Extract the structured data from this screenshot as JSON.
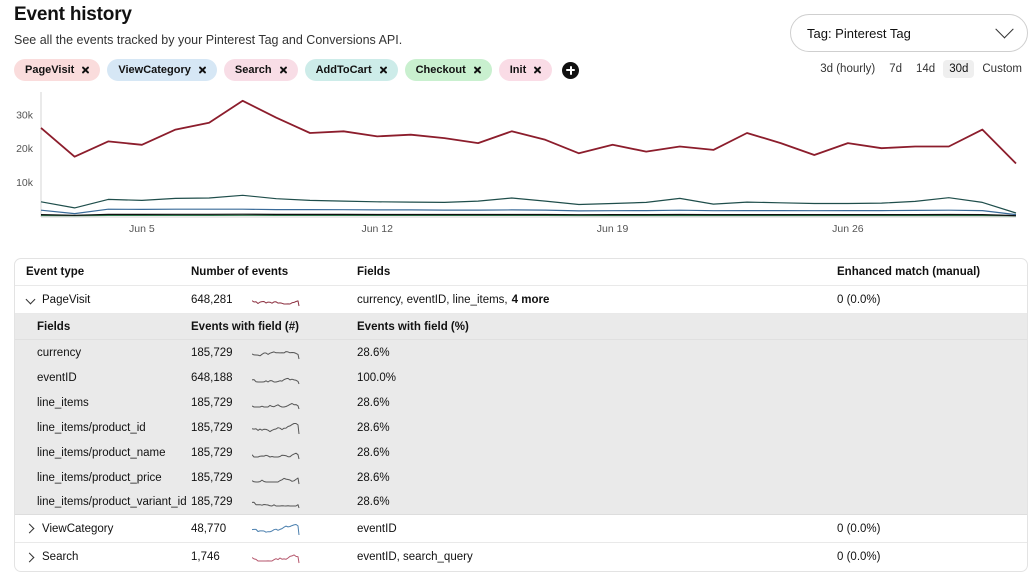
{
  "header": {
    "title": "Event history",
    "subtitle": "See all the events tracked by your Pinterest Tag and Conversions API."
  },
  "tag_select": {
    "value": "Tag: Pinterest Tag",
    "icon": "chevron-down-icon"
  },
  "filters": {
    "chips": [
      {
        "label": "PageVisit",
        "color": "#fadcdc"
      },
      {
        "label": "ViewCategory",
        "color": "#d6e7f5"
      },
      {
        "label": "Search",
        "color": "#f8dde6"
      },
      {
        "label": "AddToCart",
        "color": "#cdece9"
      },
      {
        "label": "Checkout",
        "color": "#c9f0cf"
      },
      {
        "label": "Init",
        "color": "#fadce6"
      }
    ],
    "add_button_icon": "plus-icon"
  },
  "ranges": {
    "options": [
      "3d (hourly)",
      "7d",
      "14d",
      "30d",
      "Custom"
    ],
    "selected": "30d"
  },
  "chart_data": {
    "type": "line",
    "title": "",
    "xlabel": "",
    "ylabel": "",
    "ylim": [
      0,
      36000
    ],
    "yticks": [
      10000,
      20000,
      30000
    ],
    "ytick_labels": [
      "10k",
      "20k",
      "30k"
    ],
    "xtick_labels": [
      "Jun 5",
      "Jun 12",
      "Jun 19",
      "Jun 26"
    ],
    "xtick_positions": [
      3,
      10,
      17,
      24
    ],
    "grid": false,
    "legend": "none",
    "x": [
      "Jun 2",
      "Jun 3",
      "Jun 4",
      "Jun 5",
      "Jun 6",
      "Jun 7",
      "Jun 8",
      "Jun 9",
      "Jun 10",
      "Jun 11",
      "Jun 12",
      "Jun 13",
      "Jun 14",
      "Jun 15",
      "Jun 16",
      "Jun 17",
      "Jun 18",
      "Jun 19",
      "Jun 20",
      "Jun 21",
      "Jun 22",
      "Jun 23",
      "Jun 24",
      "Jun 25",
      "Jun 26",
      "Jun 27",
      "Jun 28",
      "Jun 29",
      "Jun 30",
      "Jul 1"
    ],
    "series": [
      {
        "name": "PageVisit",
        "color": "#8c1d2c",
        "values": [
          26000,
          17500,
          22000,
          21000,
          25500,
          27500,
          34000,
          29000,
          24500,
          25000,
          23500,
          24000,
          23000,
          21500,
          25000,
          22500,
          18500,
          21000,
          19000,
          20500,
          19500,
          24500,
          21500,
          18000,
          21500,
          20000,
          20500,
          20500,
          25500,
          15500
        ]
      },
      {
        "name": "ViewCategory",
        "color": "#1f4e4b",
        "values": [
          4200,
          2400,
          4900,
          4600,
          5200,
          5300,
          6100,
          5100,
          4600,
          4400,
          4200,
          4100,
          4000,
          4400,
          5300,
          4400,
          3400,
          3700,
          4000,
          5200,
          3500,
          4100,
          3900,
          3700,
          3700,
          3800,
          4300,
          5400,
          4000,
          900
        ]
      },
      {
        "name": "Search",
        "color": "#3a6b99",
        "values": [
          1700,
          700,
          2000,
          1950,
          2000,
          2000,
          2000,
          1900,
          1900,
          1850,
          1800,
          1800,
          1750,
          1750,
          1800,
          1750,
          1500,
          1550,
          1600,
          1700,
          1550,
          1600,
          1600,
          1550,
          1600,
          1600,
          1650,
          1700,
          1600,
          400
        ]
      },
      {
        "name": "AddToCart",
        "color": "#111111",
        "values": [
          420,
          200,
          480,
          470,
          500,
          500,
          520,
          480,
          470,
          460,
          450,
          450,
          440,
          440,
          450,
          440,
          390,
          400,
          410,
          430,
          400,
          410,
          410,
          400,
          410,
          410,
          420,
          430,
          410,
          120
        ]
      },
      {
        "name": "Checkout",
        "color": "#2f7d4f",
        "values": [
          160,
          80,
          180,
          175,
          185,
          185,
          195,
          180,
          175,
          170,
          168,
          168,
          165,
          165,
          168,
          165,
          145,
          150,
          152,
          160,
          150,
          152,
          152,
          150,
          152,
          152,
          156,
          160,
          152,
          45
        ]
      }
    ]
  },
  "table": {
    "columns": [
      "Event type",
      "Number of events",
      "Fields",
      "Enhanced match (manual)"
    ],
    "sub_columns": [
      "Fields",
      "Events with field (#)",
      "Events with field (%)"
    ],
    "rows": [
      {
        "expanded": true,
        "event_type": "PageVisit",
        "number_of_events": "648,281",
        "spark_color": "#8c3040",
        "fields_text": "currency, eventID, line_items,",
        "fields_more": "4 more",
        "enhanced_match": "0 (0.0%)",
        "sub_rows": [
          {
            "field": "currency",
            "count": "185,729",
            "pct": "28.6%"
          },
          {
            "field": "eventID",
            "count": "648,188",
            "pct": "100.0%"
          },
          {
            "field": "line_items",
            "count": "185,729",
            "pct": "28.6%"
          },
          {
            "field": "line_items/product_id",
            "count": "185,729",
            "pct": "28.6%"
          },
          {
            "field": "line_items/product_name",
            "count": "185,729",
            "pct": "28.6%"
          },
          {
            "field": "line_items/product_price",
            "count": "185,729",
            "pct": "28.6%"
          },
          {
            "field": "line_items/product_variant_id",
            "count": "185,729",
            "pct": "28.6%"
          }
        ]
      },
      {
        "expanded": false,
        "event_type": "ViewCategory",
        "number_of_events": "48,770",
        "spark_color": "#4a7fae",
        "fields_text": "eventID",
        "fields_more": "",
        "enhanced_match": "0 (0.0%)",
        "sub_rows": []
      },
      {
        "expanded": false,
        "event_type": "Search",
        "number_of_events": "1,746",
        "spark_color": "#b5566c",
        "fields_text": "eventID, search_query",
        "fields_more": "",
        "enhanced_match": "0 (0.0%)",
        "sub_rows": []
      }
    ]
  }
}
